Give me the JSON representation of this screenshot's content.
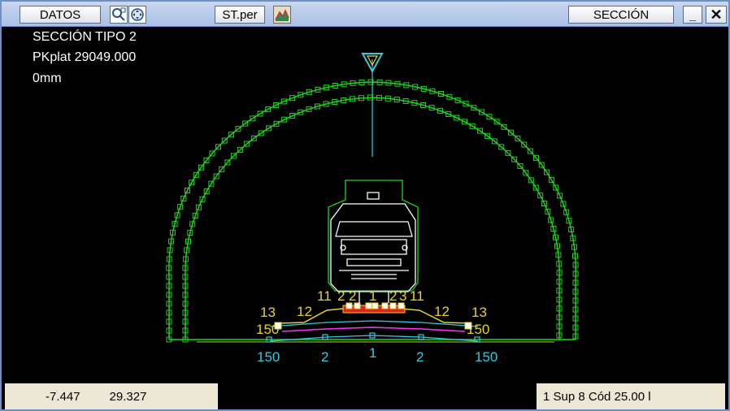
{
  "toolbar": {
    "datos_label": "DATOS",
    "profile_label": "ST.per",
    "section_label": "SECCIÓN",
    "minimize_label": "_",
    "close_label": "✕"
  },
  "info": {
    "line1": "SECCIÓN TIPO 2",
    "line2": "PKplat 29049.000",
    "line3": "0mm"
  },
  "drawing": {
    "labels_yellow": [
      "11",
      "2",
      "2",
      "1",
      "2",
      "3",
      "11",
      "13",
      "12",
      "12",
      "13",
      "150",
      "150"
    ],
    "labels_cyan": [
      "150",
      "2",
      "1",
      "2",
      "150"
    ]
  },
  "status": {
    "x_coord": "-7.447",
    "y_coord": "29.327",
    "right_text": "1 Sup 8 Cód 25.00 l"
  }
}
